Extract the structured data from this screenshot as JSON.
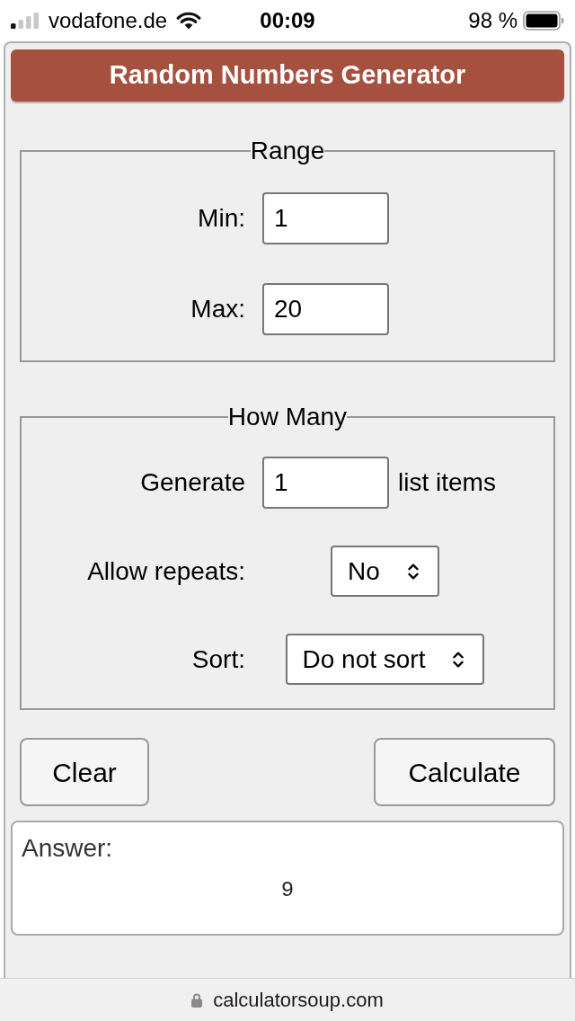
{
  "status_bar": {
    "carrier": "vodafone.de",
    "time": "00:09",
    "battery": "98 %"
  },
  "title": "Random Numbers Generator",
  "fieldsets": [
    {
      "legend": "Range",
      "rows": [
        {
          "kind": "input",
          "label": "Min:",
          "value": "1"
        },
        {
          "kind": "input",
          "label": "Max:",
          "value": "20"
        }
      ]
    },
    {
      "legend": "How Many",
      "rows": [
        {
          "kind": "input",
          "label": "Generate",
          "value": "1",
          "suffix": "list items"
        },
        {
          "kind": "select",
          "label": "Allow repeats:",
          "value": "No"
        },
        {
          "kind": "select",
          "label": "Sort:",
          "value": "Do not sort"
        }
      ]
    }
  ],
  "buttons": [
    "Clear",
    "Calculate"
  ],
  "answer": {
    "label": "Answer:",
    "value": "9"
  },
  "url_bar": {
    "domain": "calculatorsoup.com"
  }
}
